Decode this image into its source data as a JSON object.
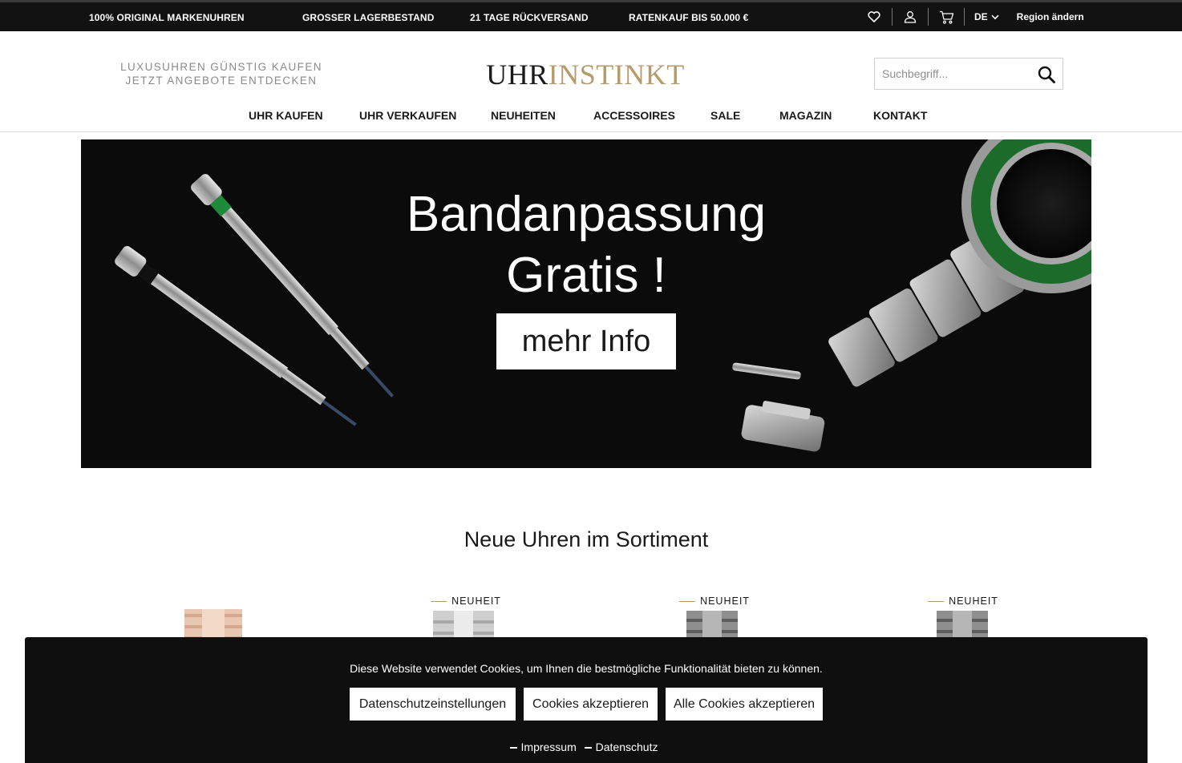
{
  "topbar": {
    "usps": [
      "100% ORIGINAL MARKENUHREN",
      "GROSSER LAGERBESTAND",
      "21 TAGE RÜCKVERSAND",
      "RATENKAUF BIS 50.000 €"
    ],
    "icons": [
      "heart-icon",
      "user-icon",
      "cart-icon",
      "chevron-down-icon"
    ],
    "language": "DE",
    "region_link": "Region ändern"
  },
  "header": {
    "tagline_line1": "LUXUSUHREN GÜNSTIG KAUFEN",
    "tagline_line2": "JETZT ANGEBOTE ENTDECKEN",
    "logo_part1": "UHR",
    "logo_part2": "INSTINKT",
    "brand_color": "#b59a6a",
    "search": {
      "placeholder": "Suchbegriff...",
      "value": "",
      "icon": "search-icon"
    }
  },
  "nav": {
    "items": [
      "UHR KAUFEN",
      "UHR VERKAUFEN",
      "NEUHEITEN",
      "ACCESSOIRES",
      "SALE",
      "MAGAZIN",
      "KONTAKT"
    ]
  },
  "hero": {
    "headline_line1": "Bandanpassung",
    "headline_line2": "Gratis !",
    "cta_label": "mehr Info"
  },
  "section": {
    "title": "Neue Uhren im Sortiment",
    "badges": [
      "NEUHEIT",
      "NEUHEIT",
      "NEUHEIT"
    ]
  },
  "cookie_banner": {
    "message": "Diese Website verwendet Cookies, um Ihnen die bestmögliche Funktionalität bieten zu können.",
    "buttons": [
      "Datenschutzeinstellungen",
      "Cookies akzeptieren",
      "Alle Cookies akzeptieren"
    ],
    "links": [
      "Impressum",
      "Datenschutz"
    ]
  }
}
